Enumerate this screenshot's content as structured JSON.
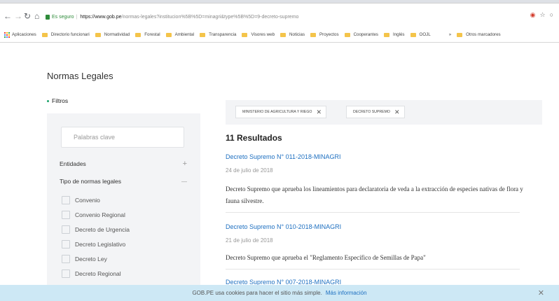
{
  "browser": {
    "back_icon": "arrow-left",
    "forward_icon": "arrow-right",
    "reload_icon": "reload",
    "home_icon": "home",
    "secure_label": "Es seguro",
    "url_host": "https://www.gob.pe",
    "url_path": "/normas-legales?institucion%5B%5D=minagri&type%5B%5D=9-decreto-supremo",
    "star_icon": "star",
    "colors": {
      "secure": "#2e8b3a",
      "folder": "#f4c44a"
    }
  },
  "bookmarks": {
    "apps_label": "Aplicaciones",
    "items": [
      "Directorio funcionari",
      "Normatividad",
      "Forestal",
      "Ambiental",
      "Transparencia",
      "Visores web",
      "Noticias",
      "Proyectos",
      "Cooperantes",
      "Inglés",
      "OOJL"
    ],
    "more_label": "»",
    "other_label": "Otros marcadores"
  },
  "page": {
    "title": "Normas Legales",
    "filters_label": "Filtros",
    "accent_color": "#1d6fc0"
  },
  "sidebar": {
    "keyword_placeholder": "Palabras clave",
    "entities_label": "Entidades",
    "entities_toggle": "+",
    "types_label": "Tipo de normas legales",
    "types_toggle": "—",
    "types": [
      "Convenio",
      "Convenio Regional",
      "Decreto de Urgencia",
      "Decreto Legislativo",
      "Decreto Ley",
      "Decreto Regional"
    ]
  },
  "chips": [
    {
      "label": "MINISTERIO DE AGRICULTURA Y RIEGO",
      "close": "✕"
    },
    {
      "label": "DECRETO SUPREMO",
      "close": "✕"
    }
  ],
  "results": {
    "count_label": "11 Resultados",
    "items": [
      {
        "title": "Decreto Supremo N° 011-2018-MINAGRI",
        "date": "24 de julio de 2018",
        "description": "Decreto Supremo que aprueba los lineamientos para declaratoria de veda a la extracción de especies nativas de flora y fauna silvestre."
      },
      {
        "title": "Decreto Supremo N° 010-2018-MINAGRI",
        "date": "21 de julio de 2018",
        "description": "Decreto Supremo que aprueba el \"Reglamento Específico de Semillas de Papa\""
      },
      {
        "title": "Decreto Supremo N° 007-2018-MINAGRI",
        "date": "",
        "description": ""
      }
    ]
  },
  "cookie": {
    "text": "GOB.PE usa cookies para hacer el sitio más simple.",
    "link": "Más información",
    "close": "✕",
    "background": "#cde8f5"
  }
}
